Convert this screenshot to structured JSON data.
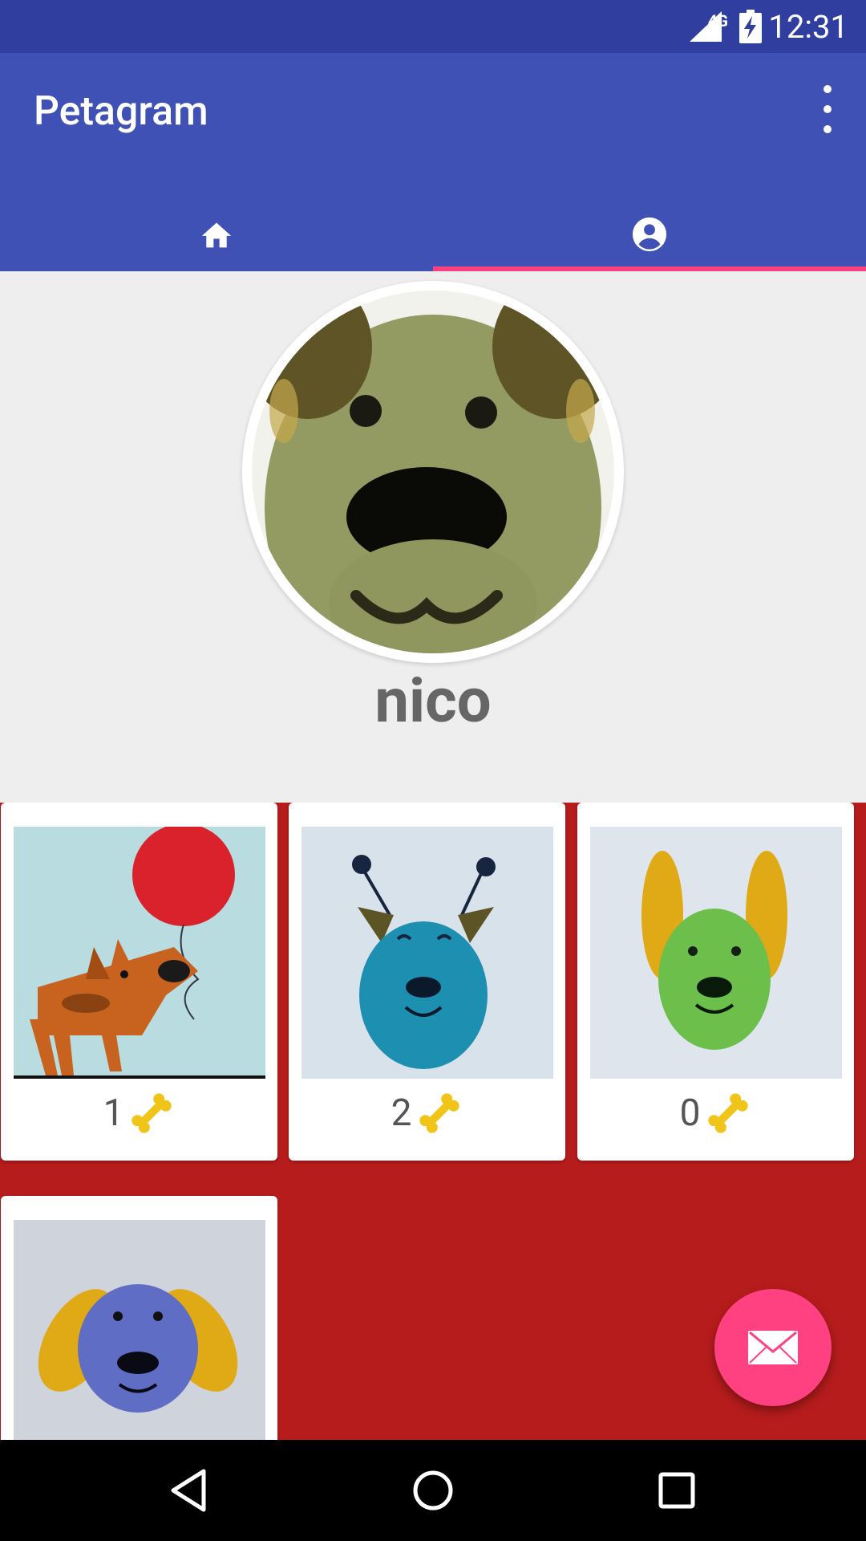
{
  "status_bar": {
    "network": "4G",
    "time": "12:31"
  },
  "app_bar": {
    "title": "Petagram"
  },
  "tabs": [
    {
      "icon": "home-icon",
      "selected": false
    },
    {
      "icon": "account-circle-icon",
      "selected": true
    }
  ],
  "profile": {
    "username": "nico"
  },
  "photos": [
    {
      "likes": "1",
      "image": "brown dog with red balloon"
    },
    {
      "likes": "2",
      "image": "blue dog with antennae"
    },
    {
      "likes": "0",
      "image": "green dog with yellow ears"
    },
    {
      "likes": "",
      "image": "purple dog with yellow ears"
    }
  ],
  "fab": {
    "icon": "mail-icon"
  },
  "colors": {
    "primary": "#3f51b5",
    "primary_dark": "#303f9f",
    "accent": "#ff4081",
    "grid_background": "#b71c1c"
  }
}
